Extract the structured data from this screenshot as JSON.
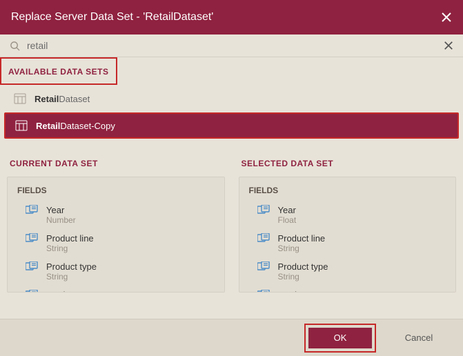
{
  "titlebar": {
    "title": "Replace Server Data Set - 'RetailDataset'"
  },
  "search": {
    "value": "retail"
  },
  "sections": {
    "available": "AVAILABLE DATA SETS",
    "current": "CURRENT DATA SET",
    "selected": "SELECTED DATA SET",
    "fields": "FIELDS"
  },
  "datasets": {
    "unselected": {
      "bold": "Retail",
      "rest": "Dataset"
    },
    "selected": {
      "bold": "Retail",
      "rest": "Dataset-Copy"
    }
  },
  "current_fields": [
    {
      "name": "Year",
      "type": "Number"
    },
    {
      "name": "Product line",
      "type": "String"
    },
    {
      "name": "Product type",
      "type": "String"
    },
    {
      "name": "Product",
      "type": ""
    }
  ],
  "selected_fields": [
    {
      "name": "Year",
      "type": "Float"
    },
    {
      "name": "Product line",
      "type": "String"
    },
    {
      "name": "Product type",
      "type": "String"
    },
    {
      "name": "Product",
      "type": ""
    }
  ],
  "buttons": {
    "ok": "OK",
    "cancel": "Cancel"
  }
}
